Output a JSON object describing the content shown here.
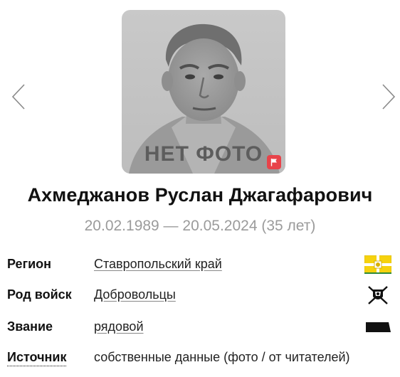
{
  "photo": {
    "placeholder_text": "НЕТ ФОТО",
    "badge_icon": "flag-icon",
    "badge_color": "#e8434a"
  },
  "navigation": {
    "prev_icon": "chevron-left-icon",
    "next_icon": "chevron-right-icon"
  },
  "person": {
    "full_name": "Ахмеджанов Руслан Джагафарович",
    "dates": "20.02.1989 — 20.05.2024 (35 лет)"
  },
  "details": [
    {
      "label": "Регион",
      "value": "Ставропольский край",
      "icon": "region-flag-icon"
    },
    {
      "label": "Род войск",
      "value": "Добровольцы",
      "icon": "volunteer-emblem-icon"
    },
    {
      "label": "Звание",
      "value": "рядовой",
      "icon": "rank-insignia-icon"
    },
    {
      "label": "Источник",
      "value": "собственные данные (фото / от читателей)"
    }
  ],
  "colors": {
    "muted_text": "#9b9b9b",
    "flag_yellow": "#f6d20e",
    "flag_green": "#2e8b3a"
  }
}
